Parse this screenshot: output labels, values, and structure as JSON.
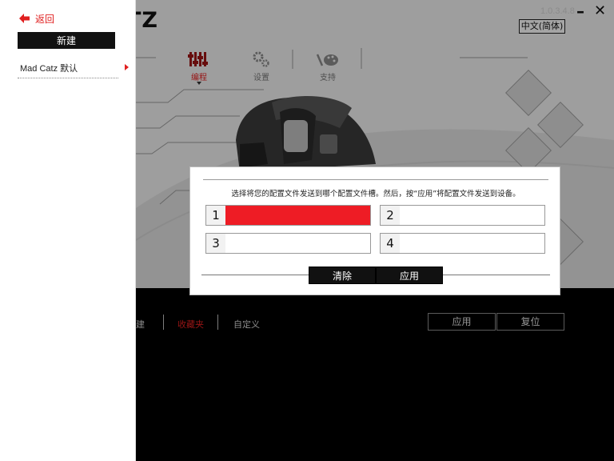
{
  "window": {
    "logo_fragment": "TZ",
    "version_text": "1.0.3.4.8",
    "language": "中文(简体)",
    "minimize_glyph": "–",
    "close_glyph": "✕"
  },
  "top_tabs": [
    {
      "label": "编程",
      "icon": "program-icon",
      "active": true
    },
    {
      "label": "设置",
      "icon": "settings-gears-icon",
      "active": false
    },
    {
      "label": "支持",
      "icon": "support-palette-icon",
      "active": false
    }
  ],
  "bottom_bar": {
    "tabs": [
      {
        "label": "建",
        "active": false
      },
      {
        "label": "收藏夹",
        "active": true
      },
      {
        "label": "自定义",
        "active": false
      }
    ],
    "apply_label": "应用",
    "reset_label": "复位"
  },
  "sidebar": {
    "back_label": "返回",
    "new_label": "新建",
    "profiles": [
      {
        "label": "Mad Catz 默认"
      }
    ]
  },
  "modal": {
    "message": "选择将您的配置文件发送到哪个配置文件槽。然后，按“应用”将配置文件发送到设备。",
    "slots": [
      {
        "number": "1",
        "selected": true
      },
      {
        "number": "2",
        "selected": false
      },
      {
        "number": "3",
        "selected": false
      },
      {
        "number": "4",
        "selected": false
      }
    ],
    "clear_label": "清除",
    "apply_label": "应用"
  },
  "colors": {
    "accent": "#ee1c25",
    "dark": "#111111"
  }
}
